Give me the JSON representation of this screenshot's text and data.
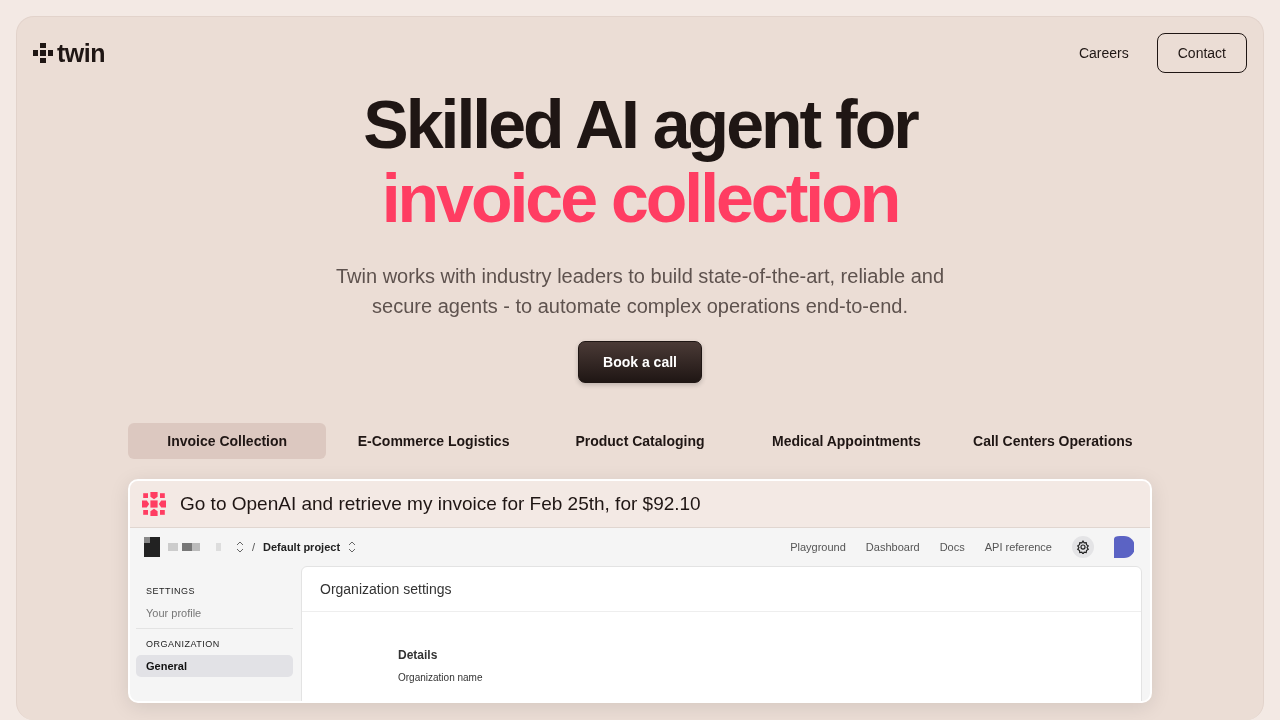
{
  "brand": {
    "name": "twin"
  },
  "nav": [
    {
      "label": "Careers",
      "kind": "link"
    },
    {
      "label": "Contact",
      "kind": "outlined"
    }
  ],
  "hero": {
    "title_line_1": "Skilled AI agent for",
    "title_line_2": "invoice collection",
    "subtitle": "Twin works with industry leaders to build state-of-the-art, reliable and secure agents - to automate complex operations end-to-end.",
    "cta": "Book a call"
  },
  "use_cases": [
    {
      "label": "Invoice Collection",
      "selected": true
    },
    {
      "label": "E-Commerce Logistics",
      "selected": false
    },
    {
      "label": "Product Cataloging",
      "selected": false
    },
    {
      "label": "Medical Appointments",
      "selected": false
    },
    {
      "label": "Call Centers Operations",
      "selected": false
    }
  ],
  "demo": {
    "prompt": "Go to OpenAI and retrieve my invoice for Feb 25th, for $92.10",
    "separator": "/",
    "project": "Default project",
    "nav_links": [
      "Playground",
      "Dashboard",
      "Docs",
      "API reference"
    ],
    "sidebar": [
      {
        "heading": "SETTINGS",
        "items": [
          {
            "label": "Your profile",
            "selected": false
          }
        ]
      },
      {
        "heading": "ORGANIZATION",
        "items": [
          {
            "label": "General",
            "selected": true
          }
        ]
      }
    ],
    "panel_title": "Organization settings",
    "section_title": "Details",
    "field_label": "Organization name"
  }
}
